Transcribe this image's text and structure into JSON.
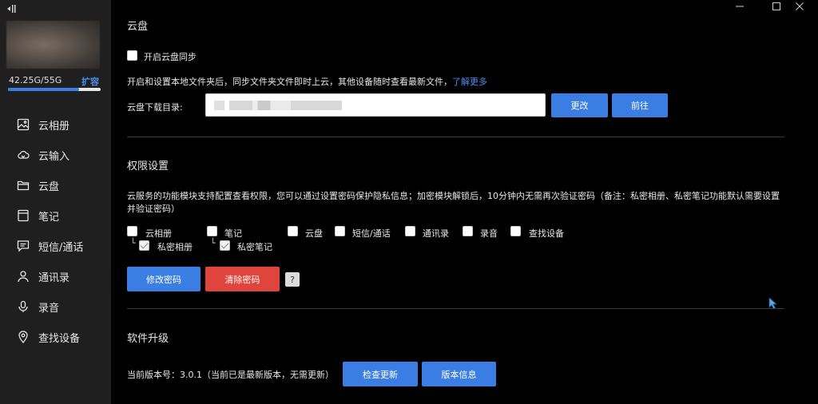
{
  "sidebar": {
    "storage": "42.25G/55G",
    "expand_label": "扩容",
    "storage_used_fraction": 0.77,
    "items": [
      {
        "label": "云相册",
        "icon": "photo-icon"
      },
      {
        "label": "云输入",
        "icon": "cloud-input-icon"
      },
      {
        "label": "云盘",
        "icon": "folder-icon"
      },
      {
        "label": "笔记",
        "icon": "note-icon"
      },
      {
        "label": "短信/通话",
        "icon": "message-icon"
      },
      {
        "label": "通讯录",
        "icon": "contacts-icon"
      },
      {
        "label": "录音",
        "icon": "microphone-icon"
      },
      {
        "label": "查找设备",
        "icon": "location-icon"
      }
    ]
  },
  "cloud_disk": {
    "title": "云盘",
    "sync_label": "开启云盘同步",
    "description": "开启和设置本地文件夹后，同步文件夹文件即时上云，其他设备随时查看最新文件，",
    "learn_more": "了解更多",
    "download_dir_label": "云盘下载目录:",
    "change_button": "更改",
    "go_button": "前往"
  },
  "permissions": {
    "title": "权限设置",
    "description_line1": "云服务的功能模块支持配置查看权限，您可以通过设置密码保护隐私信息；加密模块解锁后，10分钟内无需再次验证密码（备注：私密相册、私密笔记功能默认需要设置",
    "description_line2": "并验证密码）",
    "modules": [
      "云相册",
      "笔记",
      "云盘",
      "短信/通话",
      "通讯录",
      "录音",
      "查找设备"
    ],
    "private_album": "私密相册",
    "private_note": "私密笔记",
    "modify_button": "修改密码",
    "clear_button": "清除密码",
    "help": "?"
  },
  "upgrade": {
    "title": "软件升级",
    "version_text": "当前版本号：3.0.1（当前已是最新版本，无需更新）",
    "check_button": "检查更新",
    "info_button": "版本信息"
  },
  "colors": {
    "accent": "#3a7ee4",
    "danger": "#e0453d",
    "link": "#4a8ff0"
  }
}
